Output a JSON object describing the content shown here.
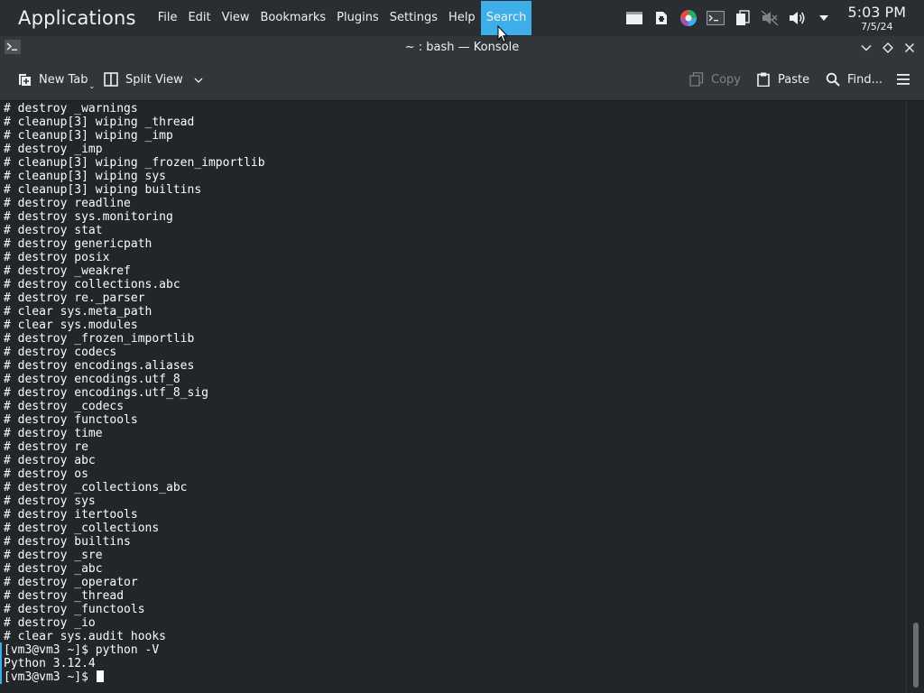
{
  "panel": {
    "app_title": "Applications",
    "menu": [
      "File",
      "Edit",
      "View",
      "Bookmarks",
      "Plugins",
      "Settings",
      "Help",
      "Search"
    ],
    "active_menu": "Search",
    "clock_time": "5:03 PM",
    "clock_date": "7/5/24",
    "tray_icons": [
      "window-icon",
      "file-icon",
      "color-wheel-icon",
      "terminal-icon",
      "clipboard-icon",
      "speaker-muted-icon",
      "volume-icon",
      "tray-expand-icon"
    ]
  },
  "window": {
    "title": "~ : bash — Konsole"
  },
  "toolbar": {
    "new_tab": "New Tab",
    "split_view": "Split View",
    "copy": "Copy",
    "paste": "Paste",
    "find": "Find..."
  },
  "terminal": {
    "lines": [
      "# destroy _warnings",
      "# cleanup[3] wiping _thread",
      "# cleanup[3] wiping _imp",
      "# destroy _imp",
      "# cleanup[3] wiping _frozen_importlib",
      "# cleanup[3] wiping sys",
      "# cleanup[3] wiping builtins",
      "# destroy readline",
      "# destroy sys.monitoring",
      "# destroy stat",
      "# destroy genericpath",
      "# destroy posix",
      "# destroy _weakref",
      "# destroy collections.abc",
      "# destroy re._parser",
      "# clear sys.meta_path",
      "# clear sys.modules",
      "# destroy _frozen_importlib",
      "# destroy codecs",
      "# destroy encodings.aliases",
      "# destroy encodings.utf_8",
      "# destroy encodings.utf_8_sig",
      "# destroy _codecs",
      "# destroy functools",
      "# destroy time",
      "# destroy re",
      "# destroy abc",
      "# destroy os",
      "# destroy _collections_abc",
      "# destroy sys",
      "# destroy itertools",
      "# destroy _collections",
      "# destroy builtins",
      "# destroy _sre",
      "# destroy _abc",
      "# destroy _operator",
      "# destroy _thread",
      "# destroy _functools",
      "# destroy _io",
      "# clear sys.audit hooks",
      "[vm3@vm3 ~]$ python -V",
      "Python 3.12.4"
    ],
    "prompt": "[vm3@vm3 ~]$ "
  },
  "colors": {
    "accent": "#3daee9",
    "background": "#232629",
    "panel": "#2a2e32",
    "toolbar": "#31363b"
  }
}
